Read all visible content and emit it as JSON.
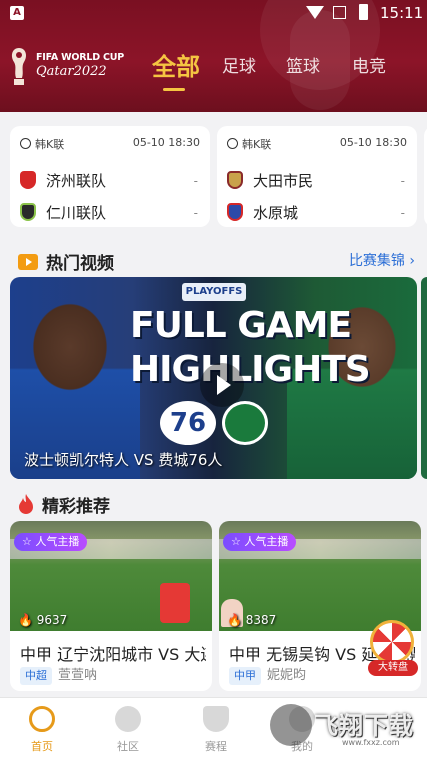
{
  "status_bar": {
    "time": "15:11"
  },
  "header": {
    "logo_line1": "FIFA WORLD CUP",
    "logo_line2": "Qatar2022",
    "tabs": [
      {
        "label": "全部",
        "active": true
      },
      {
        "label": "足球",
        "active": false
      },
      {
        "label": "篮球",
        "active": false
      },
      {
        "label": "电竞",
        "active": false
      }
    ]
  },
  "matches": [
    {
      "league": "韩K联",
      "datetime": "05-10 18:30",
      "home": "济州联队",
      "home_score": "-",
      "away": "仁川联队",
      "away_score": "-"
    },
    {
      "league": "韩K联",
      "datetime": "05-10 18:30",
      "home": "大田市民",
      "home_score": "-",
      "away": "水原城",
      "away_score": "-"
    }
  ],
  "hot_videos": {
    "title": "热门视频",
    "more_label": "比赛集锦",
    "featured": {
      "brand": "PLAYOFFS",
      "headline_line1": "FULL GAME",
      "headline_line2": "HIGHLIGHTS",
      "team_logo": "76",
      "caption": "波士顿凯尔特人 VS 费城76人"
    }
  },
  "recommend": {
    "title": "精彩推荐",
    "items": [
      {
        "badge": "人气主播",
        "views": "9637",
        "title": "中甲 辽宁沈阳城市 VS 大连",
        "category": "中超",
        "host": "萱萱呐"
      },
      {
        "badge": "人气主播",
        "views": "8387",
        "title": "中甲 无锡吴钩 VS 延边龙鼎",
        "category": "中甲",
        "host": "妮妮昀"
      }
    ],
    "wheel_label": "大转盘"
  },
  "bottom_nav": [
    {
      "label": "首页",
      "active": true
    },
    {
      "label": "社区",
      "active": false
    },
    {
      "label": "赛程",
      "active": false
    },
    {
      "label": "我的",
      "active": false
    }
  ],
  "watermark": {
    "text": "飞翔下载",
    "sub": "www.fxxz.com"
  },
  "colors": {
    "header_bg": "#8c1428",
    "accent": "#f5c542",
    "link": "#2c6fd6",
    "nav_active": "#e69a1a"
  }
}
